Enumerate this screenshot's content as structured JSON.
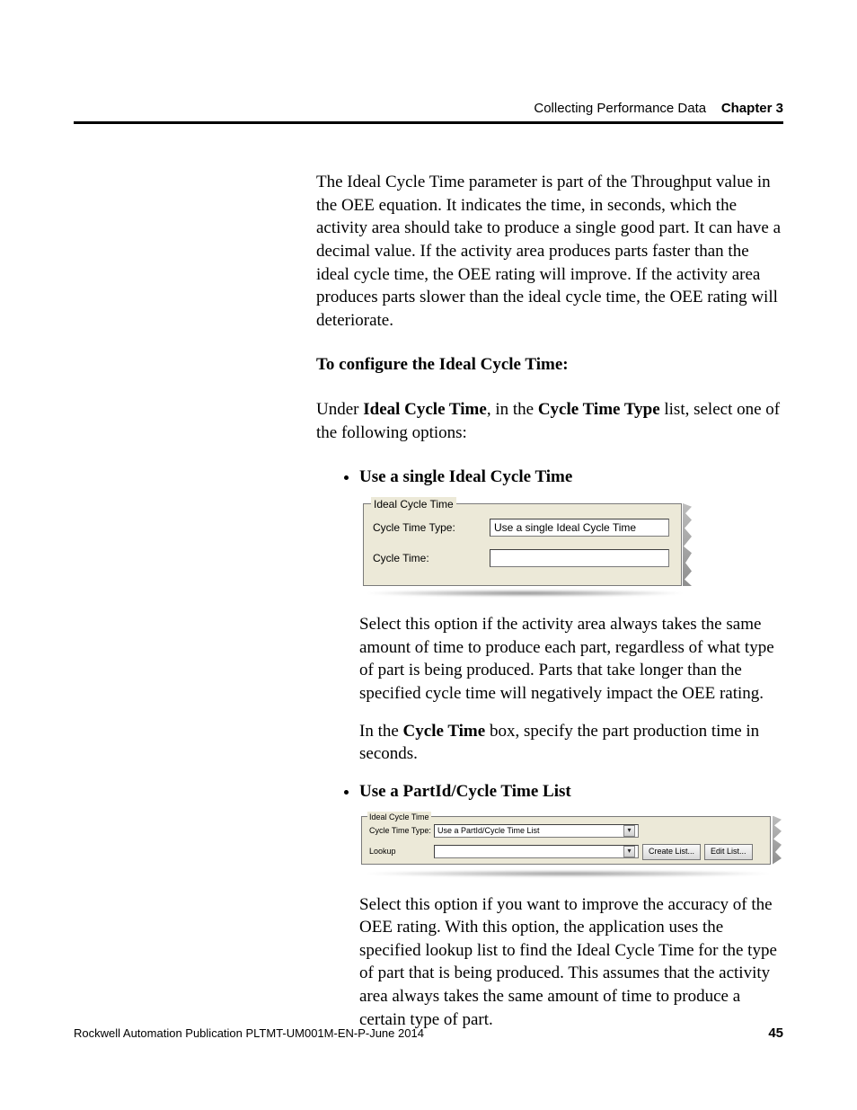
{
  "header": {
    "section": "Collecting Performance Data",
    "chapter": "Chapter 3"
  },
  "para1": "The Ideal Cycle Time parameter is part of the Throughput value in the OEE equation. It indicates the time, in seconds, which the activity area should take to produce a single good part. It can have a decimal value. If the activity area produces parts faster than the ideal cycle time, the OEE rating will improve. If the activity area produces parts slower than the ideal cycle time, the OEE rating will deteriorate.",
  "heading1": "To configure the Ideal Cycle Time:",
  "instr": {
    "pre": "Under ",
    "b1": "Ideal Cycle Time",
    "mid1": ", in the ",
    "b2": "Cycle Time Type",
    "post": " list, select one of the following options:"
  },
  "bullets": {
    "b1": {
      "title": "Use a single Ideal Cycle Time",
      "shot": {
        "legend": "Ideal Cycle Time",
        "row1_label": "Cycle Time Type:",
        "row1_value": "Use a single Ideal Cycle Time",
        "row2_label": "Cycle Time:",
        "row2_value": ""
      },
      "p1": "Select this option if the activity area always takes the same amount of time to produce each part, regardless of what type of part is being produced. Parts that take longer than the specified cycle time will negatively impact the OEE rating.",
      "p2": {
        "pre": "In the ",
        "b": "Cycle Time",
        "post": " box, specify the part production time in seconds."
      }
    },
    "b2": {
      "title": "Use a PartId/Cycle Time List",
      "shot": {
        "legend": "Ideal Cycle Time",
        "row1_label": "Cycle Time Type:",
        "row1_value": "Use a PartId/Cycle Time List",
        "row2_label": "Lookup",
        "btn1": "Create List...",
        "btn2": "Edit List..."
      },
      "p1": "Select this option if you want to improve the accuracy of the OEE rating. With this option, the application uses the specified lookup list to find the Ideal Cycle Time for the type of part that is being produced. This assumes that the activity area always takes the same amount of time to produce a certain type of part."
    }
  },
  "footer": {
    "pub": "Rockwell Automation Publication PLTMT-UM001M-EN-P-June 2014",
    "page": "45"
  }
}
